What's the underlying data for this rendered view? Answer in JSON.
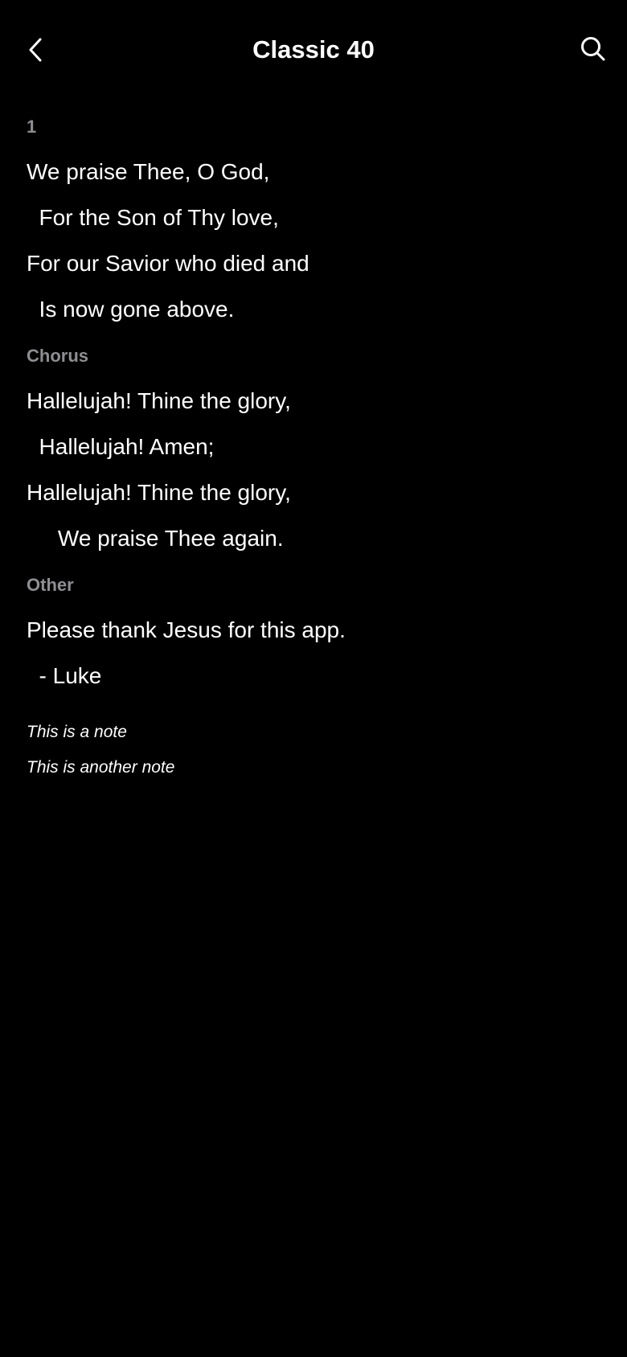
{
  "nav": {
    "back_icon": "chevron-left-icon",
    "title": "Classic 40",
    "search_icon": "search-icon"
  },
  "sections": [
    {
      "label": "1",
      "lines": [
        "We praise Thee, O God,",
        "  For the Son of Thy love,",
        "For our Savior who died and",
        "  Is now gone above."
      ]
    },
    {
      "label": "Chorus",
      "lines": [
        "Hallelujah! Thine the glory,",
        "  Hallelujah! Amen;",
        "Hallelujah! Thine the glory,",
        "     We praise Thee again."
      ]
    },
    {
      "label": "Other",
      "lines": [
        "Please thank Jesus for this app.",
        "  - Luke"
      ]
    }
  ],
  "notes": [
    "This is a note",
    "This is another note"
  ],
  "colors": {
    "background": "#000000",
    "text": "#ffffff",
    "section_label": "#8e8e93"
  }
}
